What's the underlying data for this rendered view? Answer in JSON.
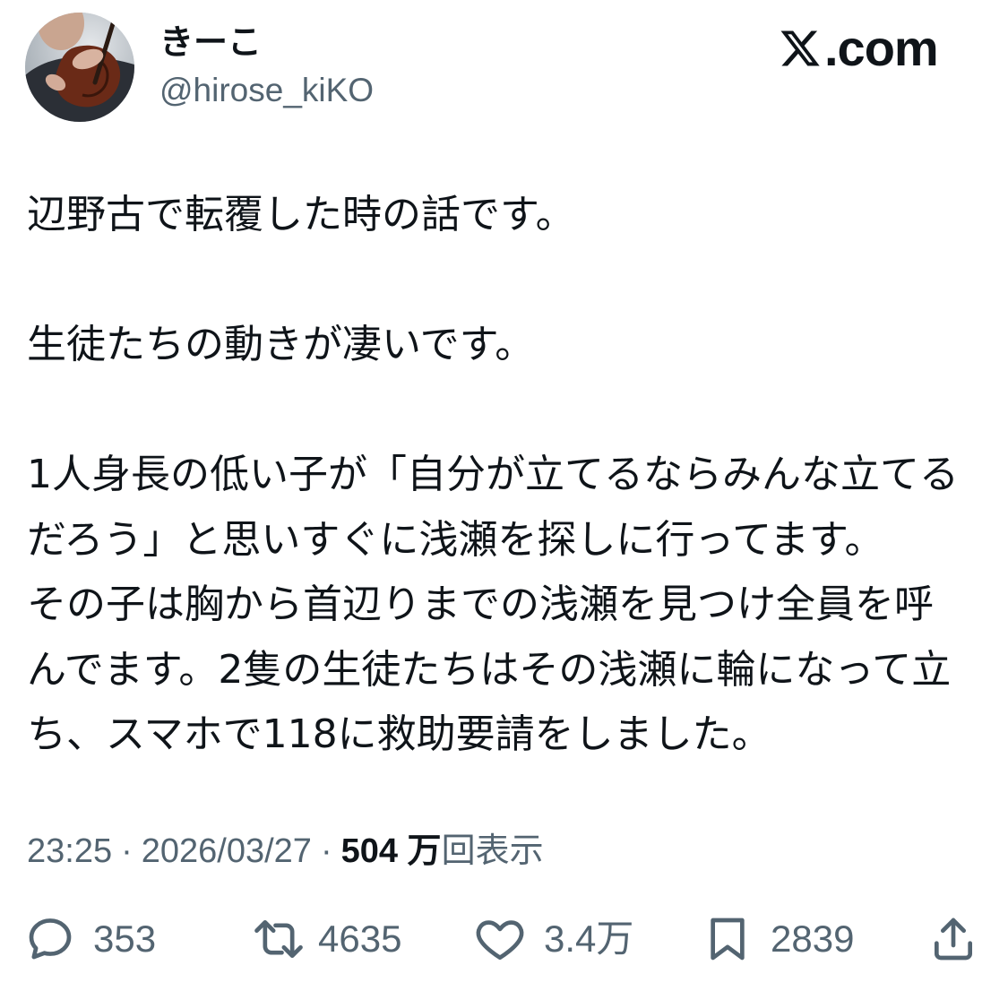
{
  "author": {
    "display_name": "きーこ",
    "handle": "@hirose_kiKO"
  },
  "brand": {
    "logo_icon": "x-logo-icon",
    "domain_suffix": ".com"
  },
  "post": {
    "paragraphs": [
      [
        "辺野古で転覆した時の話です。"
      ],
      [
        "生徒たちの動きが凄いです。"
      ],
      [
        "1人身長の低い子が「自分が立てるならみんな立てる",
        "だろう」と思いすぐに浅瀬を探しに行ってます。",
        "その子は胸から首辺りまでの浅瀬を見つけ全員を呼",
        "んでます。2隻の生徒たちはその浅瀬に輪になって立",
        "ち、スマホで118に救助要請をしました。"
      ]
    ]
  },
  "meta": {
    "time": "23:25",
    "separator": "·",
    "date": "2026/03/27",
    "views_count": "504 万",
    "views_label": "回表示"
  },
  "actions": {
    "reply": {
      "icon": "reply-icon",
      "count": "353"
    },
    "repost": {
      "icon": "repost-icon",
      "count": "4635"
    },
    "like": {
      "icon": "heart-icon",
      "count": "3.4万"
    },
    "bookmark": {
      "icon": "bookmark-icon",
      "count": "2839"
    },
    "share": {
      "icon": "share-icon"
    }
  },
  "colors": {
    "text": "#0f1419",
    "secondary": "#536471",
    "background": "#ffffff"
  }
}
